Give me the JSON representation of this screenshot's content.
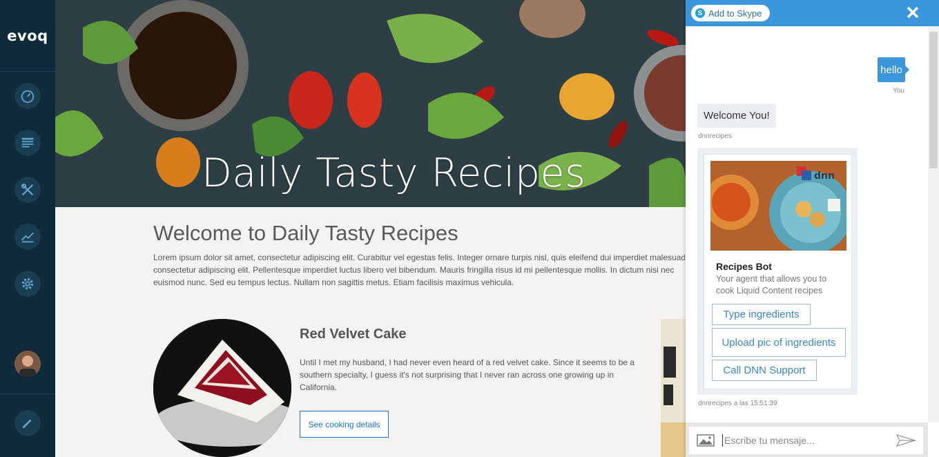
{
  "sidebar": {
    "logo": "evoq",
    "items": [
      {
        "icon": "dashboard-icon"
      },
      {
        "icon": "content-icon"
      },
      {
        "icon": "tools-icon"
      },
      {
        "icon": "analytics-icon"
      },
      {
        "icon": "settings-icon"
      }
    ],
    "edit_icon": "pencil-icon"
  },
  "hero": {
    "title": "Daily Tasty Recipes"
  },
  "main": {
    "title": "Welcome to Daily Tasty Recipes",
    "intro_lines": [
      "Lorem ipsum dolor sit amet, consectetur adipiscing elit. Curabitur vel egestas felis. Integer ornare turpis nisl, quis eleifend dui imperdiet malesuada",
      "consectetur adipiscing elit. Pellentesque imperdiet luctus libero vel bibendum. Mauris fringilla risus id mi pellentesque mollis. In dictum nisi nec",
      "euismod nunc. Sed eu tempus lectus. Nullam non sagittis metus. Etiam facilisis maximus vehicula."
    ],
    "recipe": {
      "title": "Red Velvet Cake",
      "desc_lines": [
        "Until I met my husband, I had never even heard of a red velvet cake. Since it seems to be a",
        "southern specialty, I guess it's not surprising that I never ran across one growing up in",
        "California."
      ],
      "button": "See cooking details"
    }
  },
  "chat": {
    "header": {
      "skype_label": "Add to Skype",
      "close_icon": "close-icon"
    },
    "messages": {
      "user_text": "hello",
      "user_meta": "You",
      "bot_text": "Welcome You!",
      "bot_meta": "dnnrecipes"
    },
    "card": {
      "title": "Recipes Bot",
      "subtitle": "Your agent that allows you to cook Liquid Content recipes",
      "buttons": [
        "Type ingredients",
        "Upload pic of ingredients",
        "Call DNN Support"
      ],
      "timestamp": "dnnrecipes a las 15:51:39"
    },
    "input": {
      "placeholder": "Escribe tu mensaje..."
    }
  },
  "colors": {
    "sidebar": "#0e2a3b",
    "accent": "#3a96dd",
    "link": "#1a73c7"
  }
}
